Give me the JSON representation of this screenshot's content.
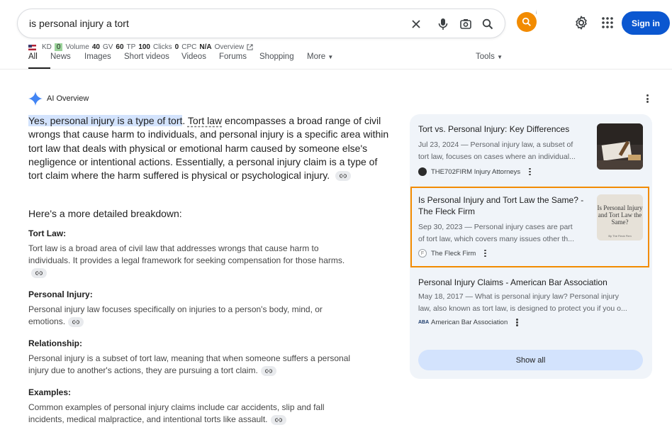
{
  "search": {
    "query": "is personal injury a tort",
    "signin_label": "Sign in",
    "superscript": "i"
  },
  "seo": {
    "kd_label": "KD",
    "kd_value": "0",
    "volume_label": "Volume",
    "volume_value": "40",
    "gv_label": "GV",
    "gv_value": "60",
    "tp_label": "TP",
    "tp_value": "100",
    "clicks_label": "Clicks",
    "clicks_value": "0",
    "cpc_label": "CPC",
    "cpc_value": "N/A",
    "overview_label": "Overview"
  },
  "tabs": [
    "All",
    "News",
    "Images",
    "Short videos",
    "Videos",
    "Forums",
    "Shopping",
    "More"
  ],
  "tools_label": "Tools",
  "ai": {
    "heading": "AI Overview",
    "intro_highlight": "Yes, personal injury is a type of tort",
    "intro_dot": ".",
    "intro_link": "Tort law",
    "intro_rest": "encompasses a broad range of civil wrongs that cause harm to individuals, and personal injury is a specific area within tort law that deals with physical or emotional harm caused by someone else's negligence or intentional actions. Essentially, a personal injury claim is a type of tort claim where the harm suffered is physical or psychological injury.",
    "breakdown": "Here's a more detailed breakdown:",
    "sections": [
      {
        "title": "Tort Law:",
        "body": "Tort law is a broad area of civil law that addresses wrongs that cause harm to individuals. It provides a legal framework for seeking compensation for those harms."
      },
      {
        "title": "Personal Injury:",
        "body": "Personal injury law focuses specifically on injuries to a person's body, mind, or emotions."
      },
      {
        "title": "Relationship:",
        "body": "Personal injury is a subset of tort law, meaning that when someone suffers a personal injury due to another's actions, they are pursuing a tort claim."
      },
      {
        "title": "Examples:",
        "body": "Common examples of personal injury claims include car accidents, slip and fall incidents, medical malpractice, and intentional torts like assault."
      }
    ]
  },
  "sources": [
    {
      "title": "Tort vs. Personal Injury: Key Differences",
      "snippet_line1": "Jul 23, 2024 — Personal injury law, a subset of",
      "snippet_line2": "tort law, focuses on cases where an individual...",
      "site": "THE702FIRM Injury Attorneys"
    },
    {
      "title": "Is Personal Injury and Tort Law the Same? - The Fleck Firm",
      "snippet_line1": "Sep 30, 2023 — Personal injury cases are part",
      "snippet_line2": "of tort law, which covers many issues other th...",
      "site": "The Fleck Firm",
      "thumb_text": "Is Personal Injury and Tort Law the Same?",
      "thumb_caption": "By The Fleck Firm"
    },
    {
      "title": "Personal Injury Claims - American Bar Association",
      "snippet_line1": "May 18, 2017 — What is personal injury law? Personal injury",
      "snippet_line2": "law, also known as tort law, is designed to protect you if you o...",
      "site": "American Bar Association"
    }
  ],
  "show_all_label": "Show all",
  "colors": {
    "accent_orange": "#f28b00",
    "signin_blue": "#0b57d0",
    "highlight": "#d3e3fd",
    "panel_bg": "#f0f4f9"
  }
}
